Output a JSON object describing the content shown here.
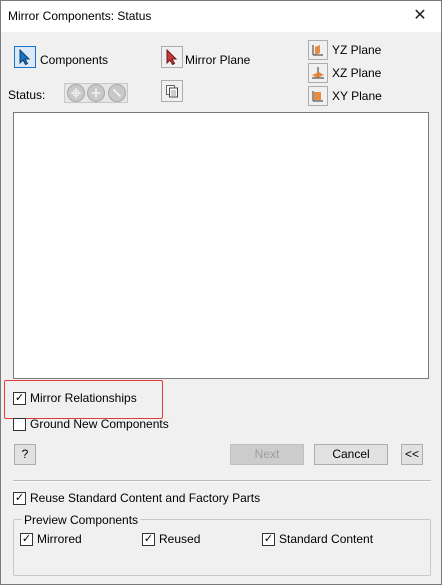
{
  "window": {
    "title": "Mirror Components: Status",
    "close_glyph": "✕"
  },
  "select": {
    "components_label": "Components",
    "mirror_plane_label": "Mirror Plane"
  },
  "planes": [
    {
      "label": "YZ Plane",
      "icon": "yz-plane-icon"
    },
    {
      "label": "XZ Plane",
      "icon": "xz-plane-icon"
    },
    {
      "label": "XY Plane",
      "icon": "xy-plane-icon"
    }
  ],
  "status": {
    "label": "Status:",
    "icons": [
      "mirror-status-icon",
      "reuse-status-icon",
      "exclude-status-icon"
    ]
  },
  "options": {
    "mirror_relationships": {
      "label": "Mirror Relationships",
      "checked": true
    },
    "ground_new_components": {
      "label": "Ground New Components",
      "checked": false
    },
    "reuse_standard": {
      "label": "Reuse Standard Content and Factory Parts",
      "checked": true
    }
  },
  "buttons": {
    "help": "?",
    "next": "Next",
    "cancel": "Cancel",
    "collapse": "<<"
  },
  "preview": {
    "title": "Preview Components",
    "mirrored": {
      "label": "Mirrored",
      "checked": true
    },
    "reused": {
      "label": "Reused",
      "checked": true
    },
    "standard_content": {
      "label": "Standard Content",
      "checked": true
    }
  },
  "colors": {
    "accent": "#1a73c4",
    "highlight": "#e03b3b",
    "plane_icon": "#e07a2a"
  }
}
